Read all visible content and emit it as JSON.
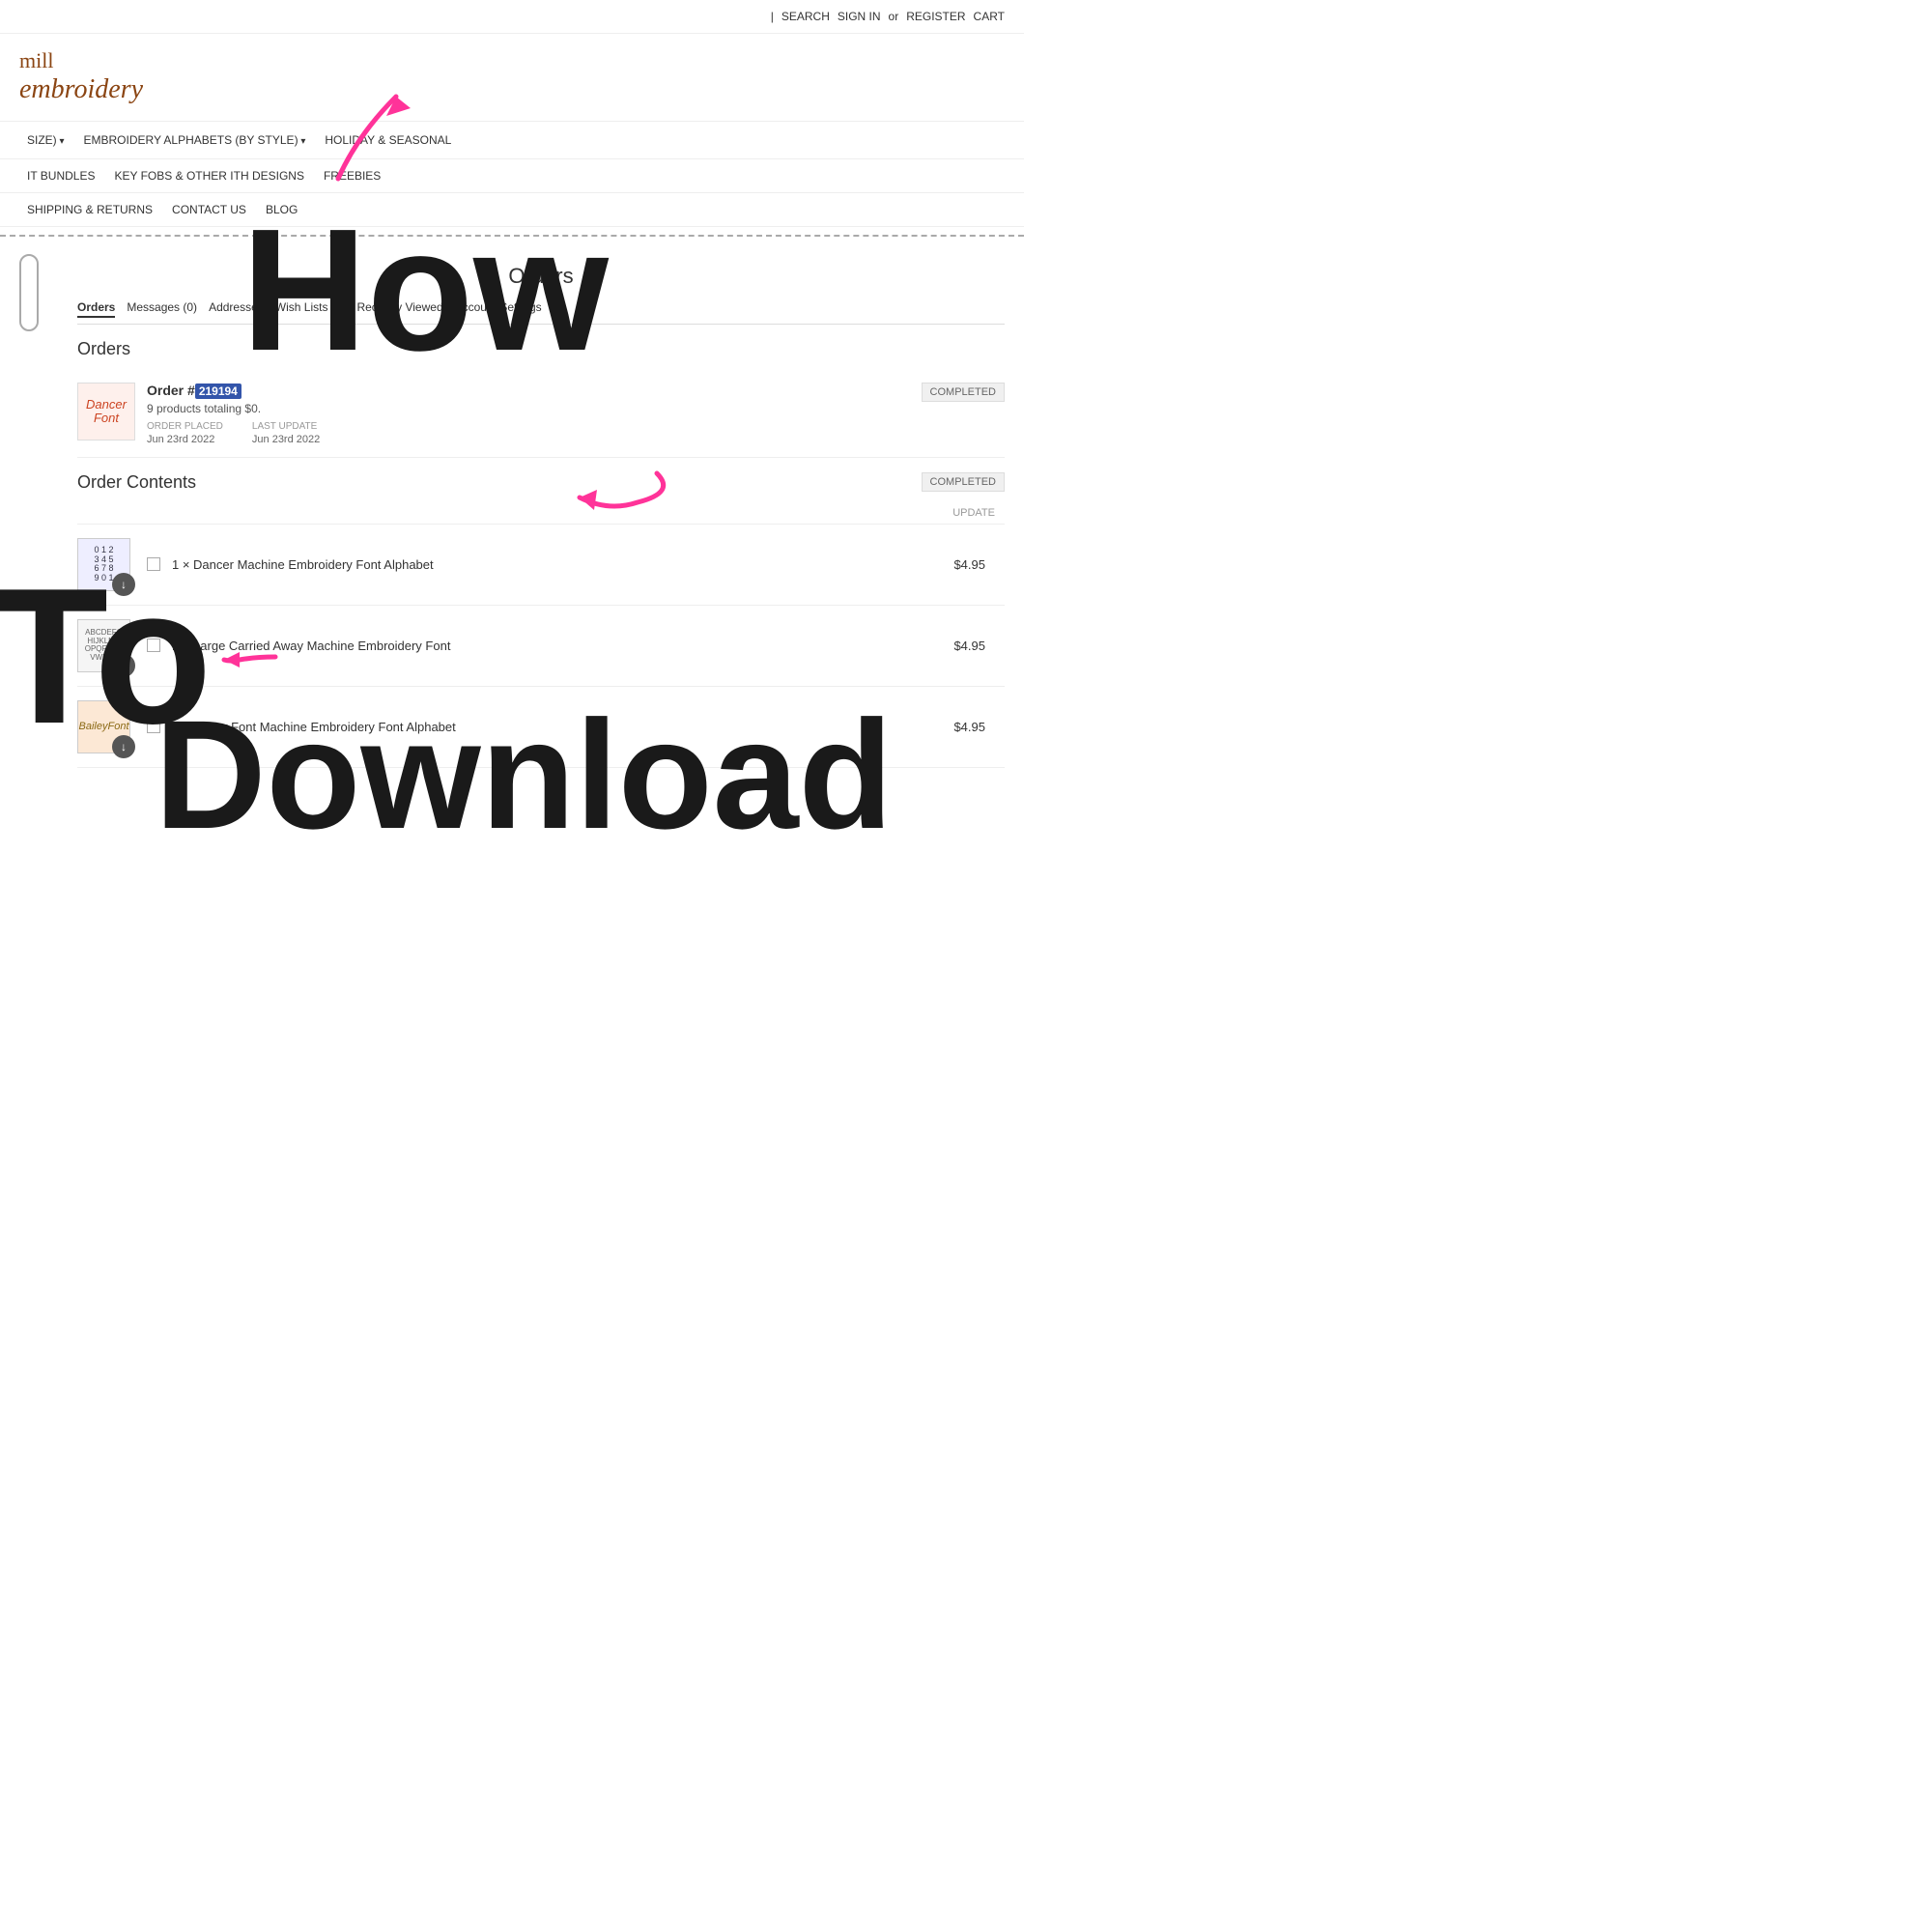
{
  "site": {
    "name_line1": "mill",
    "name_line2": "embroidery",
    "top_nav": {
      "search": "SEARCH",
      "sign_in": "SIGN IN",
      "or": "or",
      "register": "REGISTER",
      "cart": "CART"
    }
  },
  "main_nav": [
    {
      "label": "SIZE)",
      "has_arrow": true
    },
    {
      "label": "EMBROIDERY ALPHABETS (BY STYLE)",
      "has_arrow": true
    },
    {
      "label": "HOLIDAY & SEASONAL",
      "has_arrow": false
    }
  ],
  "sub_nav_row1": [
    {
      "label": "IT BUNDLES"
    },
    {
      "label": "KEY FOBS & OTHER ITH DESIGNS"
    },
    {
      "label": "FREEBIES"
    }
  ],
  "sub_nav_row2": [
    {
      "label": "SHIPPING & RETURNS"
    },
    {
      "label": "CONTACT US"
    },
    {
      "label": "BLOG"
    }
  ],
  "page_title": "Orders",
  "account_tabs": [
    {
      "label": "Orders",
      "active": true
    },
    {
      "label": "Messages (0)"
    },
    {
      "label": "Addresses"
    },
    {
      "label": "Wish Lists (2)"
    },
    {
      "label": "Recently Viewed"
    },
    {
      "label": "Account Settings"
    }
  ],
  "orders_section_label": "Orders",
  "order": {
    "order_label": "Order #",
    "order_number": "219194",
    "products_summary": "9 products totaling $0.",
    "order_placed_label": "ORDER PLACED",
    "order_placed_date": "Jun 23rd 2022",
    "last_update_label": "LAST UPDATE",
    "last_update_date": "Jun 23rd 2022",
    "status": "COMPLETED"
  },
  "order_contents": {
    "title": "Order Contents",
    "status": "COMPLETED",
    "products_header_update": "UPDATE",
    "products": [
      {
        "name": "1 × Dancer Machine Embroidery Font Alphabet",
        "price": "$4.95",
        "thumb_type": "dancer"
      },
      {
        "name": "1 × Large Carried Away Machine Embroidery Font",
        "price": "$4.95",
        "thumb_type": "carried"
      },
      {
        "name": "1 × Bailey Font Machine Embroidery Font Alphabet",
        "price": "$4.95",
        "thumb_type": "bailey"
      }
    ]
  },
  "overlay_texts": {
    "how": "How",
    "to": "To",
    "download": "Download"
  }
}
